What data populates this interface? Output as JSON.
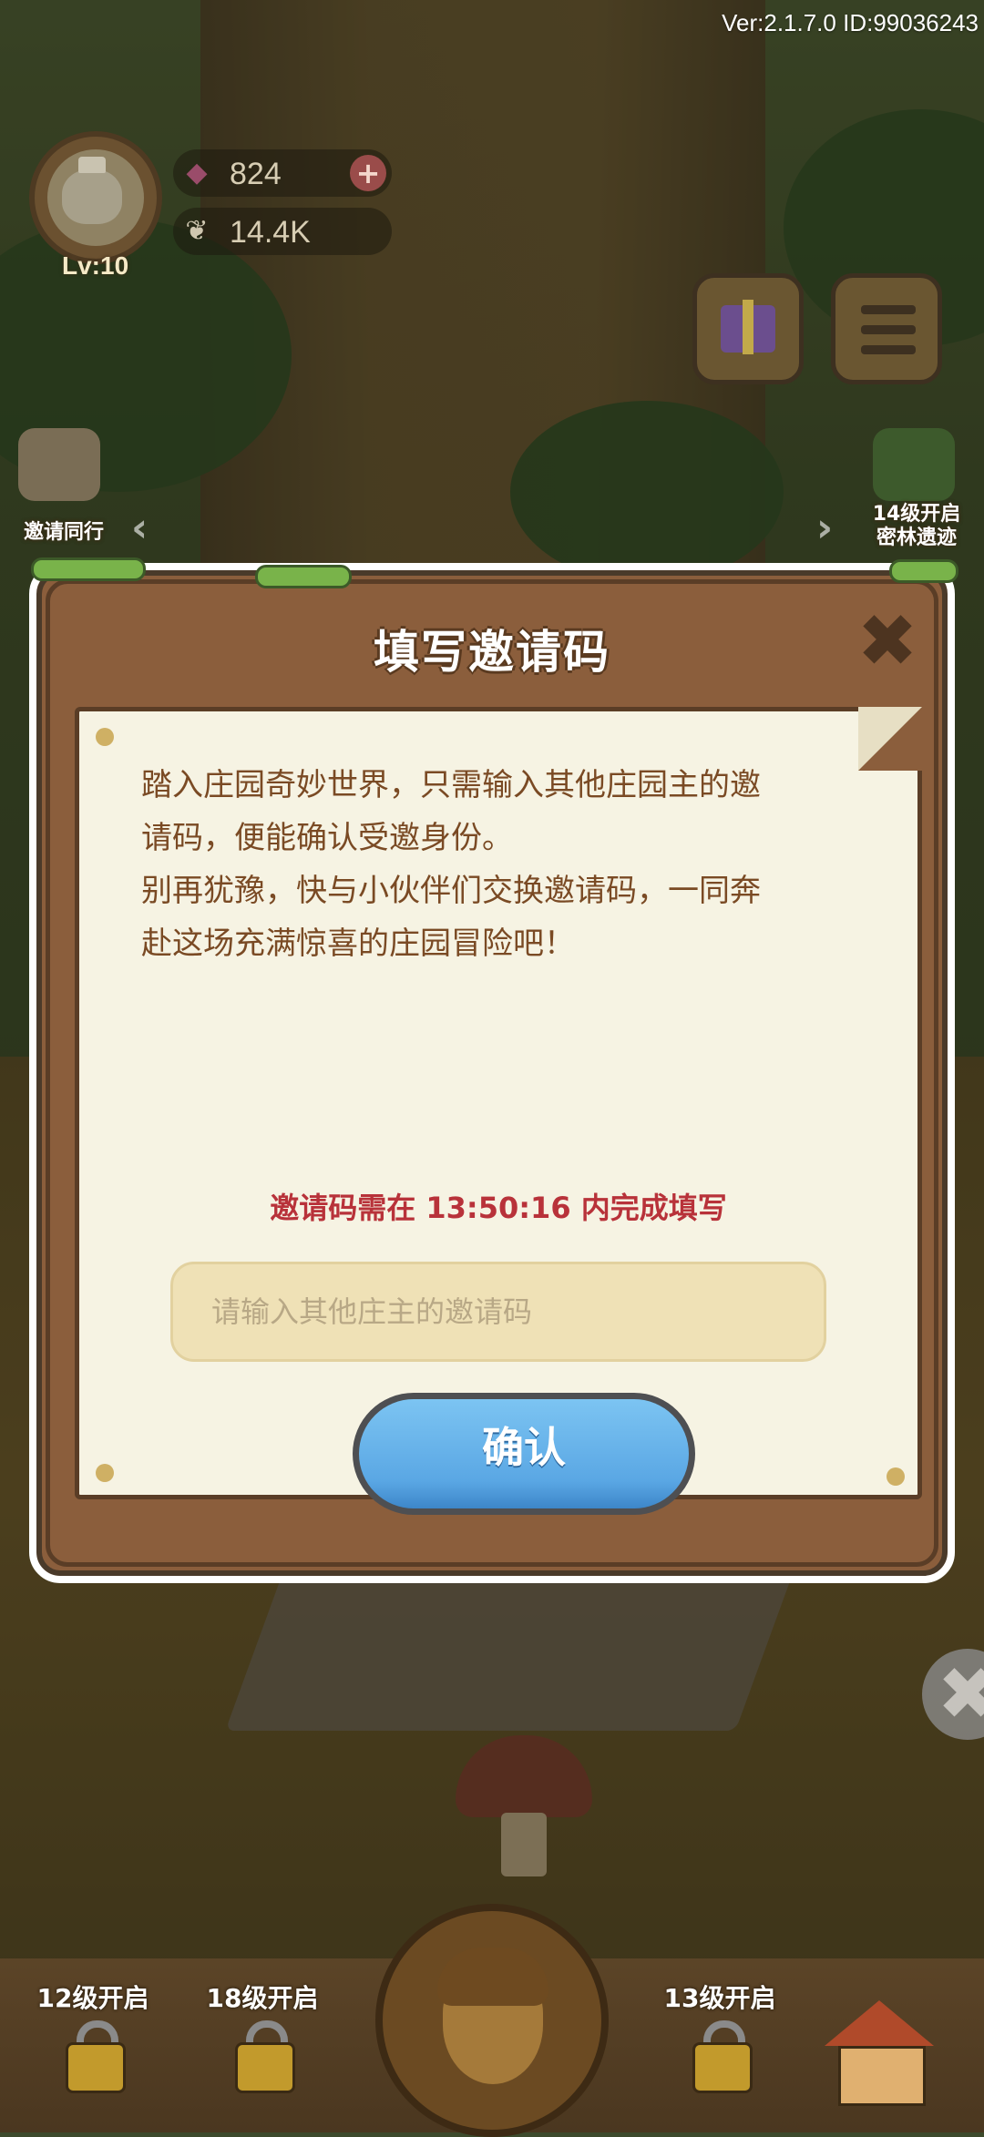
{
  "hud": {
    "version": "Ver:2.1.7.0 ID:99036243",
    "level": "Lv:10",
    "gems": "824",
    "seeds": "14.4K",
    "side_left_label": "邀请同行",
    "side_right_label_1": "14级开启",
    "side_right_label_2": "密林遗迹"
  },
  "dialog": {
    "title": "填写邀请码",
    "line1": "踏入庄园奇妙世界，只需输入其他庄园主的邀",
    "line2": "请码，便能确认受邀身份。",
    "line3": "别再犹豫，快与小伙伴们交换邀请码，一同奔",
    "line4": "赴这场充满惊喜的庄园冒险吧！",
    "deadline": "邀请码需在 13:50:16 内完成填写",
    "input_placeholder": "请输入其他庄主的邀请码",
    "input_value": "",
    "confirm_label": "确认"
  },
  "bottom_bar": {
    "slot1_label": "12级开启",
    "slot2_label": "18级开启",
    "slot3_label": "13级开启"
  },
  "colors": {
    "dialog_frame": "#8b5e3c",
    "paper": "#f6f3e3",
    "body_text": "#7a4a24",
    "deadline_text": "#b8323a",
    "input_bg": "#efe1b6",
    "confirm_button": "#5aa7e4"
  },
  "icons": {
    "close": "close-icon",
    "gem": "gem-icon",
    "seed": "seed-icon",
    "gift": "gift-icon",
    "menu": "menu-icon",
    "lock": "lock-icon",
    "acorn": "acorn-icon",
    "house": "house-icon"
  }
}
